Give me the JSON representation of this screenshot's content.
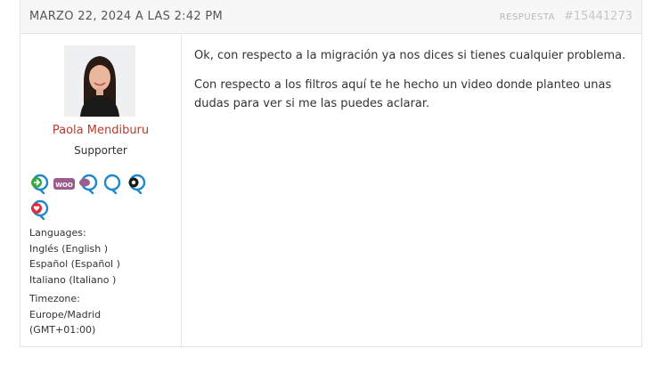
{
  "reply": {
    "date": "MARZO 22, 2024 A LAS 2:42 PM",
    "label": "RESPUESTA",
    "id": "#15441273"
  },
  "author": {
    "name": "Paola Mendiburu",
    "role": "Supporter",
    "avatar_alt": "Paola Mendiburu",
    "badges": [
      "wpml-support-icon",
      "woo-badge",
      "woocommerce-support-icon",
      "support-icon",
      "translation-support-icon",
      "heart-support-icon"
    ],
    "languages_label": "Languages:",
    "languages": [
      "Inglés (English )",
      "Español (Español )",
      "Italiano (Italiano )"
    ],
    "timezone_label": "Timezone:",
    "timezone_lines": [
      "Europe/Madrid",
      "(GMT+01:00)"
    ]
  },
  "content": {
    "paragraphs": [
      "Ok, con respecto a la migración ya nos dices si tienes cualquier problema.",
      "Con respecto a los filtros aquí te he hecho un video donde planteo unas dudas para ver si me las puedes aclarar."
    ]
  },
  "colors": {
    "author_name": "#c0392b",
    "badge_blue": "#1f88c9",
    "woo_purple": "#9b5c8f",
    "border": "#e4e4e4",
    "header_bg": "#f7f7f7"
  }
}
